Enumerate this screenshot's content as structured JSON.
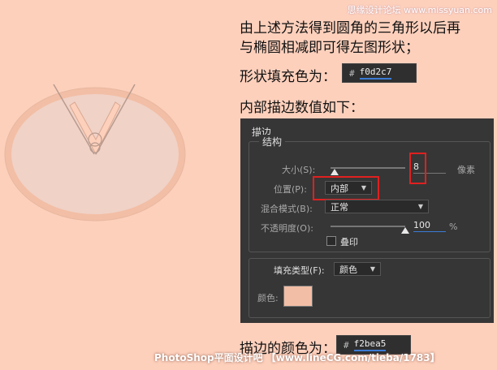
{
  "watermark_top": "思缘设计论坛 www.missyuan.com",
  "intro_line1": "由上述方法得到圆角的三角形以后再",
  "intro_line2": "与椭圆相减即可得左图形状；",
  "fill_label": "形状填充色为：",
  "fill_hex": "f0d2c7",
  "inner_stroke_label": "内部描边数值如下：",
  "stroke_color_label": "描边的颜色为：",
  "stroke_hex": "f2bea5",
  "hash_symbol": "#",
  "bottom_watermark": "PhotoShop平面设计吧 【www.lineCG.com/tieba/1783】",
  "colors": {
    "fill": "#f0d2c7",
    "stroke": "#f2bea5",
    "accent": "#3a7bd5",
    "highlight": "#e02020"
  },
  "panel": {
    "title": "描边",
    "structure_label": "结构",
    "size_label": "大小(S):",
    "size_value": "8",
    "size_unit": "像素",
    "size_level": 0.05,
    "position_label": "位置(P):",
    "position_value": "内部",
    "blend_label": "混合模式(B):",
    "blend_value": "正常",
    "opacity_label": "不透明度(O):",
    "opacity_value": "100",
    "opacity_unit": "%",
    "opacity_level": 1.0,
    "overprint_label": "叠印",
    "fill_type_label": "填充类型(F):",
    "fill_type_value": "颜色",
    "color_label": "颜色:"
  }
}
